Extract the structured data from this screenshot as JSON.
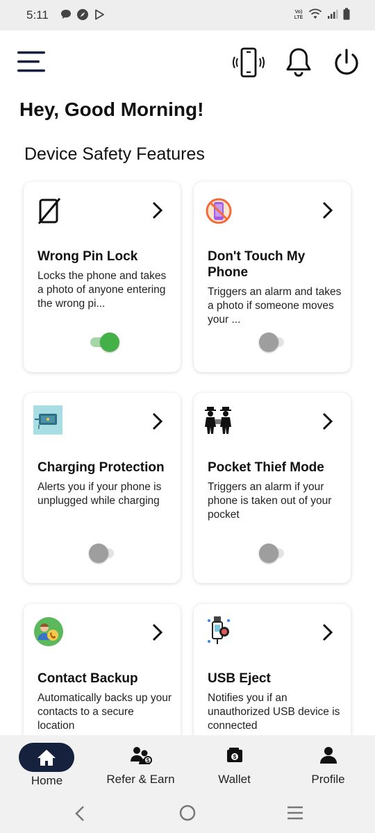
{
  "status_bar": {
    "time": "5:11",
    "left_icons": [
      "chat-bubble-icon",
      "compass-icon",
      "play-store-icon"
    ],
    "right_icons": [
      "volte-icon",
      "wifi-icon",
      "signal-icon",
      "battery-icon"
    ],
    "volte_label": "Vo) LTE"
  },
  "header": {
    "icons": [
      "menu-icon",
      "vibrate-phone-icon",
      "bell-icon",
      "power-icon"
    ]
  },
  "greeting": "Hey, Good Morning!",
  "section_title": "Device Safety Features",
  "features": [
    {
      "title": "Wrong Pin Lock",
      "description": "Locks the phone and takes a photo of anyone entering the wrong pi...",
      "icon": "no-phone-lock-icon",
      "enabled": true
    },
    {
      "title": "Don't Touch My Phone",
      "description": "Triggers an alarm and takes a photo if someone moves your ...",
      "icon": "no-touch-phone-icon",
      "enabled": false
    },
    {
      "title": "Charging Protection",
      "description": "Alerts you if your phone is unplugged while charging",
      "icon": "charging-plug-icon",
      "enabled": false
    },
    {
      "title": "Pocket Thief Mode",
      "description": "Triggers an alarm if your phone is taken out of your pocket",
      "icon": "pocket-thief-icon",
      "enabled": false
    },
    {
      "title": "Contact Backup",
      "description": "Automatically backs up your contacts to a secure location",
      "icon": "contact-backup-icon",
      "enabled": false
    },
    {
      "title": "USB Eject",
      "description": "Notifies you if an unauthorized USB device is connected",
      "icon": "usb-eject-icon",
      "enabled": false
    }
  ],
  "bottom_nav": {
    "home": "Home",
    "refer": "Refer & Earn",
    "wallet": "Wallet",
    "profile": "Profile",
    "active": "Home"
  },
  "system_nav": [
    "back-icon",
    "home-circle-icon",
    "recents-icon"
  ],
  "colors": {
    "accent_dark": "#15213d",
    "toggle_on": "#43b048",
    "toggle_off": "#9e9e9e",
    "nav_background": "#f1f1f1"
  }
}
